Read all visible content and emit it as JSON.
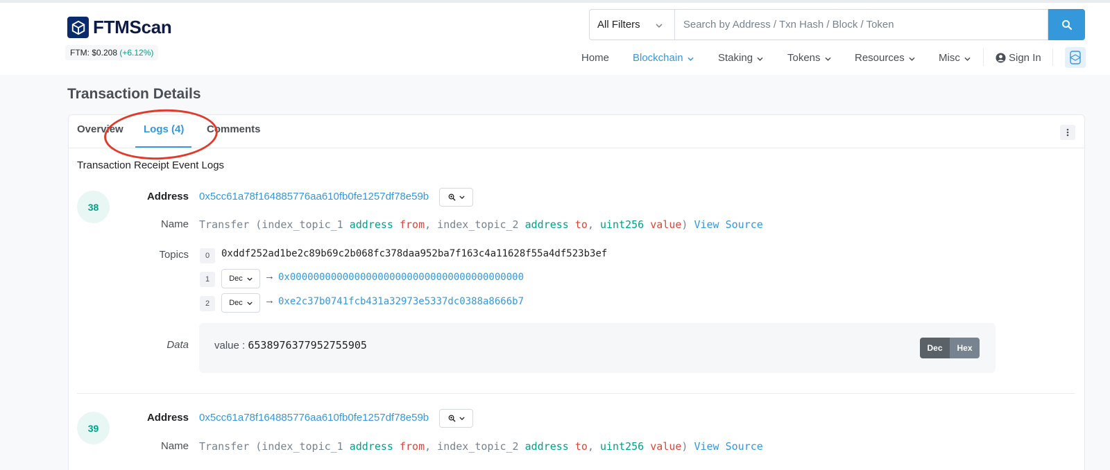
{
  "header": {
    "brand": "FTMScan",
    "price_label": "FTM: $0.208",
    "price_change": "(+6.12%)",
    "search": {
      "filter_value": "All Filters",
      "placeholder": "Search by Address / Txn Hash / Block / Token"
    },
    "nav": {
      "home": "Home",
      "blockchain": "Blockchain",
      "staking": "Staking",
      "tokens": "Tokens",
      "resources": "Resources",
      "misc": "Misc",
      "sign_in": "Sign In"
    }
  },
  "page": {
    "title": "Transaction Details",
    "tabs": {
      "overview": "Overview",
      "logs": "Logs (4)",
      "comments": "Comments"
    },
    "subheading": "Transaction Receipt Event Logs"
  },
  "labels": {
    "address": "Address",
    "name": "Name",
    "topics": "Topics",
    "data": "Data"
  },
  "logs": [
    {
      "number": "38",
      "address": "0x5cc61a78f164885776aa610fb0fe1257df78e59b",
      "signature": {
        "func": "Transfer (index_topic_1 ",
        "t1": "address",
        "n1": " from",
        "sep1": ", index_topic_2 ",
        "t2": "address",
        "n2": " to",
        "sep2": ", ",
        "t3": "uint256",
        "n3": " value",
        "close": ")",
        "view_source": "View Source"
      },
      "topics": [
        {
          "index": "0",
          "value": "0xddf252ad1be2c89b69c2b068fc378daa952ba7f163c4a11628f55a4df523b3ef"
        },
        {
          "index": "1",
          "format": "Dec",
          "arrow": "→",
          "value": "0x0000000000000000000000000000000000000000"
        },
        {
          "index": "2",
          "format": "Dec",
          "arrow": "→",
          "value": "0xe2c37b0741fcb431a32973e5337dc0388a8666b7"
        }
      ],
      "data": {
        "key": "value : ",
        "value": "6538976377952755905",
        "toggle_dec": "Dec",
        "toggle_hex": "Hex"
      }
    },
    {
      "number": "39",
      "address": "0x5cc61a78f164885776aa610fb0fe1257df78e59b",
      "signature": {
        "func": "Transfer (index_topic_1 ",
        "t1": "address",
        "n1": " from",
        "sep1": ", index_topic_2 ",
        "t2": "address",
        "n2": " to",
        "sep2": ", ",
        "t3": "uint256",
        "n3": " value",
        "close": ")",
        "view_source": "View Source"
      }
    }
  ],
  "colors": {
    "accent": "#3498db",
    "green": "#00a186",
    "red": "#de4437",
    "annotation": "#e03a2a"
  },
  "icons": [
    "cube-logo-icon",
    "chevron-down-icon",
    "search-icon",
    "user-circle-icon",
    "fantom-icon",
    "vertical-dots-icon",
    "zoom-icon"
  ]
}
